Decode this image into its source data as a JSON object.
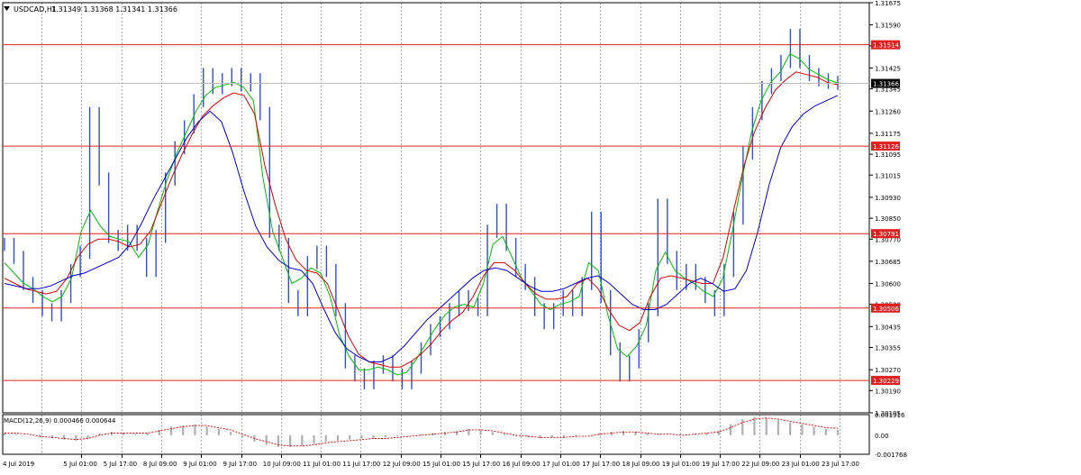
{
  "header": {
    "symbol": "USDCAD,H1",
    "ohlc": "1.31349 1.31368 1.31341 1.31366",
    "menu_icon": "triangle-down-icon"
  },
  "colors": {
    "background": "#ffffff",
    "grid": "#c0c0c0",
    "price": "#3050d0",
    "ma_fast": "#00c000",
    "ma_mid": "#e00000",
    "ma_slow": "#0000d0",
    "hline": "#e02020",
    "macd_hist": "#b0b0b0",
    "macd_signal": "#e00000",
    "current_price_bg": "#000000"
  },
  "macd": {
    "label": "MACD(12,26,9) 0.000466 0.000644",
    "ticks": [
      "0.001916",
      "0.00",
      "-0.001768"
    ],
    "range": [
      -0.001768,
      0.001916
    ]
  },
  "chart_data": {
    "type": "line",
    "title": "USDCAD,H1",
    "ylim": [
      1.30105,
      1.31675
    ],
    "grid": true,
    "y_ticks": [
      1.31675,
      1.3159,
      1.3151,
      1.31425,
      1.31345,
      1.3126,
      1.31175,
      1.31095,
      1.31015,
      1.3093,
      1.3085,
      1.3077,
      1.30685,
      1.306,
      1.3052,
      1.30435,
      1.30355,
      1.3027,
      1.3019,
      1.30105
    ],
    "y_tick_labels": [
      "1.31675",
      "1.31590",
      "1.31510",
      "1.31425",
      "1.31345",
      "1.31260",
      "1.31175",
      "1.31095",
      "1.31015",
      "1.30930",
      "1.30850",
      "1.30770",
      "1.30685",
      "1.30600",
      "1.30520",
      "1.30435",
      "1.30355",
      "1.30270",
      "1.30190",
      "1.30105"
    ],
    "x_labels": [
      "4 Jul 2019",
      "5 Jul 01:00",
      "5 Jul 17:00",
      "8 Jul 09:00",
      "9 Jul 01:00",
      "9 Jul 17:00",
      "10 Jul 09:00",
      "11 Jul 01:00",
      "11 Jul 17:00",
      "12 Jul 09:00",
      "15 Jul 01:00",
      "15 Jul 17:00",
      "16 Jul 09:00",
      "17 Jul 01:00",
      "17 Jul 17:00",
      "18 Jul 09:00",
      "19 Jul 01:00",
      "19 Jul 17:00",
      "22 Jul 09:00",
      "23 Jul 01:00",
      "23 Jul 17:00"
    ],
    "horizontal_levels": [
      {
        "value": 1.31514,
        "label": "1.31514"
      },
      {
        "value": 1.31126,
        "label": "1.31126"
      },
      {
        "value": 1.30791,
        "label": "1.30791"
      },
      {
        "value": 1.30506,
        "label": "1.30506"
      },
      {
        "value": 1.30229,
        "label": "1.30229"
      }
    ],
    "current_price": {
      "value": 1.31366,
      "label": "1.31366"
    },
    "series": [
      {
        "role": "close",
        "values": [
          1.3075,
          1.307,
          1.306,
          1.3055,
          1.305,
          1.3048,
          1.3055,
          1.3065,
          1.3072,
          1.3125,
          1.31,
          1.3078,
          1.3075,
          1.308,
          1.3075,
          1.3065,
          1.3078,
          1.31,
          1.3112,
          1.312,
          1.313,
          1.314,
          1.3135,
          1.3138,
          1.314,
          1.3136,
          1.3138,
          1.3125,
          1.308,
          1.3075,
          1.3055,
          1.305,
          1.3068,
          1.3072,
          1.3065,
          1.305,
          1.303,
          1.3025,
          1.3022,
          1.3028,
          1.303,
          1.3025,
          1.3022,
          1.3028,
          1.3035,
          1.3042,
          1.3045,
          1.305,
          1.3055,
          1.3052,
          1.305,
          1.308,
          1.3088,
          1.3075,
          1.3065,
          1.306,
          1.305,
          1.3045,
          1.305,
          1.3055,
          1.305,
          1.306,
          1.3085,
          1.3055,
          1.3035,
          1.3025,
          1.303,
          1.304,
          1.305,
          1.309,
          1.307,
          1.306,
          1.3065,
          1.306,
          1.3055,
          1.305,
          1.3065,
          1.3085,
          1.311,
          1.3125,
          1.3135,
          1.314,
          1.3145,
          1.3155,
          1.3145,
          1.314,
          1.3138,
          1.3137,
          1.31366
        ]
      },
      {
        "role": "ma_fast",
        "values": [
          1.3068,
          1.3064,
          1.306,
          1.3058,
          1.3055,
          1.3053,
          1.3055,
          1.3062,
          1.308,
          1.3088,
          1.3082,
          1.3078,
          1.3077,
          1.3076,
          1.307,
          1.3075,
          1.3088,
          1.31,
          1.311,
          1.3118,
          1.3126,
          1.3132,
          1.3135,
          1.3136,
          1.3137,
          1.3135,
          1.313,
          1.31,
          1.308,
          1.307,
          1.306,
          1.3062,
          1.3066,
          1.3064,
          1.3055,
          1.304,
          1.3032,
          1.3027,
          1.3027,
          1.3028,
          1.3027,
          1.3025,
          1.3026,
          1.3031,
          1.3037,
          1.3043,
          1.3048,
          1.3051,
          1.3052,
          1.3051,
          1.306,
          1.3075,
          1.3078,
          1.307,
          1.3062,
          1.3057,
          1.3052,
          1.305,
          1.3052,
          1.3053,
          1.3055,
          1.3068,
          1.3065,
          1.3048,
          1.3035,
          1.3032,
          1.3036,
          1.3044,
          1.3065,
          1.3072,
          1.3065,
          1.3062,
          1.306,
          1.3057,
          1.3055,
          1.3062,
          1.308,
          1.31,
          1.3118,
          1.313,
          1.3137,
          1.3141,
          1.3148,
          1.3146,
          1.3142,
          1.314,
          1.3138,
          1.31368
        ]
      },
      {
        "role": "ma_mid",
        "values": [
          1.3062,
          1.306,
          1.3058,
          1.3057,
          1.3056,
          1.3057,
          1.3062,
          1.307,
          1.3075,
          1.3077,
          1.3077,
          1.3076,
          1.3074,
          1.3075,
          1.308,
          1.309,
          1.31,
          1.3109,
          1.3117,
          1.3124,
          1.3128,
          1.3131,
          1.3133,
          1.3132,
          1.3125,
          1.3105,
          1.309,
          1.3077,
          1.3069,
          1.3065,
          1.3064,
          1.306,
          1.305,
          1.304,
          1.3033,
          1.303,
          1.3029,
          1.3028,
          1.3028,
          1.303,
          1.3033,
          1.3037,
          1.3042,
          1.3046,
          1.3049,
          1.3055,
          1.3063,
          1.3068,
          1.3068,
          1.3065,
          1.306,
          1.3056,
          1.3054,
          1.3054,
          1.3055,
          1.306,
          1.3062,
          1.3058,
          1.305,
          1.3044,
          1.3042,
          1.3045,
          1.3055,
          1.3062,
          1.3063,
          1.3062,
          1.3061,
          1.306,
          1.306,
          1.307,
          1.3088,
          1.3105,
          1.3118,
          1.3127,
          1.3134,
          1.3138,
          1.3141,
          1.314,
          1.3139,
          1.3137,
          1.31361
        ]
      },
      {
        "role": "ma_slow",
        "values": [
          1.306,
          1.3059,
          1.3058,
          1.3058,
          1.3059,
          1.3061,
          1.3063,
          1.3064,
          1.3066,
          1.3068,
          1.307,
          1.3075,
          1.3083,
          1.3092,
          1.31,
          1.3108,
          1.3116,
          1.3122,
          1.3126,
          1.3122,
          1.311,
          1.3095,
          1.3082,
          1.3074,
          1.3069,
          1.3066,
          1.3065,
          1.306,
          1.305,
          1.3041,
          1.3035,
          1.3032,
          1.303,
          1.303,
          1.3032,
          1.3036,
          1.3041,
          1.3046,
          1.305,
          1.3054,
          1.3058,
          1.3062,
          1.3065,
          1.3066,
          1.3065,
          1.3062,
          1.3059,
          1.3057,
          1.3057,
          1.3058,
          1.306,
          1.3062,
          1.3063,
          1.306,
          1.3056,
          1.3052,
          1.305,
          1.305,
          1.3052,
          1.3056,
          1.306,
          1.3062,
          1.306,
          1.3057,
          1.3058,
          1.3065,
          1.308,
          1.3098,
          1.3112,
          1.312,
          1.3125,
          1.3128,
          1.313,
          1.3132
        ]
      }
    ],
    "macd_histogram": [
      0.0002,
      0.0001,
      0.0,
      -0.0002,
      -0.0003,
      -0.0004,
      -0.0005,
      -0.0003,
      0.0002,
      0.0003,
      0.0002,
      0.0001,
      0.0002,
      0.0005,
      0.0008,
      0.0009,
      0.001,
      0.0008,
      0.0006,
      0.0003,
      -0.0002,
      -0.0006,
      -0.0009,
      -0.0011,
      -0.0011,
      -0.001,
      -0.0008,
      -0.0006,
      -0.0005,
      -0.0004,
      -0.0003,
      -0.0003,
      -0.0002,
      -0.0001,
      0.0,
      0.0001,
      0.0002,
      0.0003,
      0.0004,
      0.0006,
      0.0005,
      0.0003,
      0.0001,
      -0.0001,
      -0.0002,
      -0.0003,
      -0.0002,
      -0.0002,
      -0.0001,
      0.0,
      0.0002,
      0.0003,
      0.0004,
      0.0003,
      0.0002,
      0.0001,
      0.0,
      0.0,
      0.0001,
      0.0002,
      0.0004,
      0.001,
      0.0015,
      0.0017,
      0.0016,
      0.0014,
      0.0012,
      0.001,
      0.0008,
      0.0006,
      0.0005
    ],
    "macd_signal": [
      0.0002,
      0.0002,
      0.0001,
      -0.0001,
      -0.0002,
      -0.0003,
      -0.0004,
      -0.0003,
      0.0,
      0.0002,
      0.0002,
      0.0002,
      0.0002,
      0.0004,
      0.0006,
      0.0008,
      0.0009,
      0.0009,
      0.0007,
      0.0005,
      0.0001,
      -0.0003,
      -0.0006,
      -0.0009,
      -0.001,
      -0.001,
      -0.0009,
      -0.0007,
      -0.0006,
      -0.0005,
      -0.0004,
      -0.0003,
      -0.0003,
      -0.0002,
      -0.0001,
      0.0,
      0.0001,
      0.0002,
      0.0003,
      0.0005,
      0.0005,
      0.0004,
      0.0002,
      0.0,
      -0.0001,
      -0.0002,
      -0.0002,
      -0.0002,
      -0.0001,
      -0.0001,
      0.0001,
      0.0002,
      0.0003,
      0.0003,
      0.0002,
      0.0001,
      0.0001,
      0.0,
      0.0001,
      0.0002,
      0.0003,
      0.0007,
      0.0012,
      0.0015,
      0.0016,
      0.0015,
      0.0013,
      0.0011,
      0.0009,
      0.0007,
      0.000644
    ]
  }
}
